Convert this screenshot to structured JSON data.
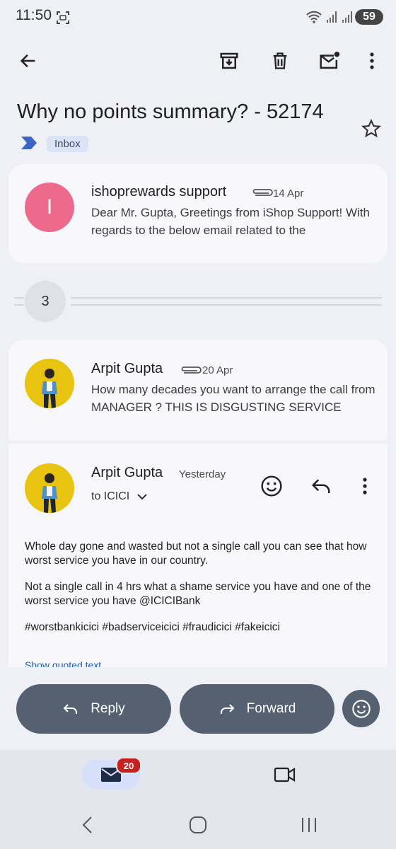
{
  "status_bar": {
    "time": "11:50",
    "battery": "59"
  },
  "toolbar": {
    "icons": [
      "back-arrow-icon",
      "archive-icon",
      "delete-icon",
      "mark-unread-icon",
      "more-vert-icon"
    ]
  },
  "thread": {
    "subject": "Why no points summary? - 52174",
    "label": "Inbox"
  },
  "messages": [
    {
      "sender": "ishoprewards support",
      "date": "14 Apr",
      "avatar_initial": "I",
      "avatar_color": "#ee6a8c",
      "snippet": "Dear Mr. Gupta, Greetings from iShop Support! With regards to the below email related to the"
    },
    {
      "sender": "Arpit Gupta",
      "date": "20 Apr",
      "snippet": "How many decades you want to arrange the call from MANAGER ? THIS IS DISGUSTING SERVICE"
    }
  ],
  "collapsed_count": "3",
  "expanded_message": {
    "sender": "Arpit Gupta",
    "date": "Yesterday",
    "recipient": "to ICICI",
    "body": [
      "Whole day gone and wasted but not a single call you can see that how worst service you have in our country.",
      "Not a single call in 4 hrs what a shame service you have and one of the worst service you have @ICICIBank",
      "#worstbankicici #badserviceicici #fraudicici #fakeicici"
    ],
    "show_quoted": "Show quoted text"
  },
  "actions": {
    "reply": "Reply",
    "forward": "Forward"
  },
  "bottom_nav": {
    "mail_badge": "20"
  },
  "colors": {
    "accent_pill": "#556071",
    "badge": "#c5221f",
    "chip_bg": "#dde3f6"
  }
}
